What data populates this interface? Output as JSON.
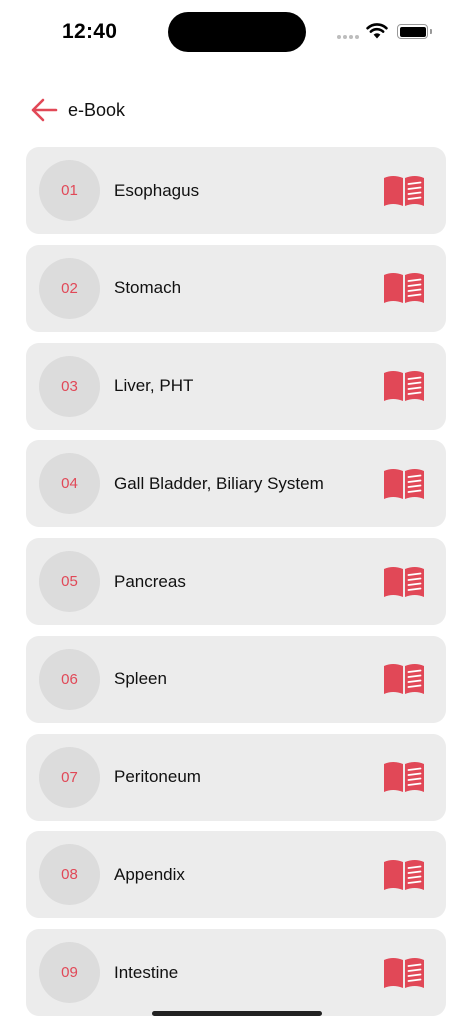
{
  "status_bar": {
    "time": "12:40"
  },
  "header": {
    "title": "e-Book",
    "back_icon": "arrow-left-icon"
  },
  "colors": {
    "accent": "#e14857",
    "card_bg": "#ececec",
    "badge_bg": "#dcdcdc"
  },
  "chapters": [
    {
      "number": "01",
      "title": "Esophagus",
      "icon": "open-book-icon"
    },
    {
      "number": "02",
      "title": "Stomach",
      "icon": "open-book-icon"
    },
    {
      "number": "03",
      "title": "Liver, PHT",
      "icon": "open-book-icon"
    },
    {
      "number": "04",
      "title": "Gall Bladder, Biliary System",
      "icon": "open-book-icon"
    },
    {
      "number": "05",
      "title": "Pancreas",
      "icon": "open-book-icon"
    },
    {
      "number": "06",
      "title": "Spleen",
      "icon": "open-book-icon"
    },
    {
      "number": "07",
      "title": "Peritoneum",
      "icon": "open-book-icon"
    },
    {
      "number": "08",
      "title": "Appendix",
      "icon": "open-book-icon"
    },
    {
      "number": "09",
      "title": "Intestine",
      "icon": "open-book-icon"
    }
  ]
}
